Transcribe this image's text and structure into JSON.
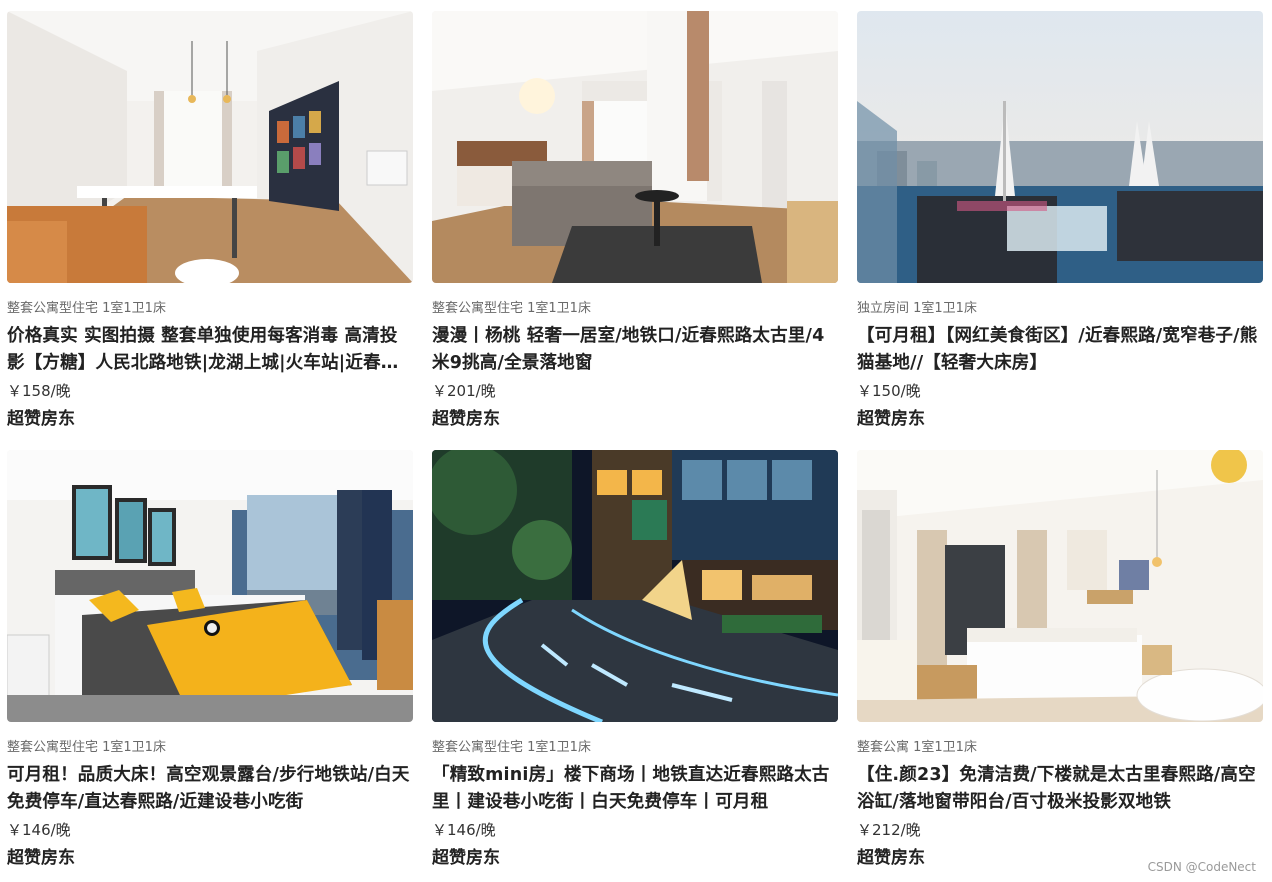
{
  "listings": [
    {
      "type": "整套公寓型住宅 1室1卫1床",
      "title": "价格真实 实图拍摄 整套单独使用每客消毒 高清投影【方糖】人民北路地铁|龙湖上城|火车站|近春熙路",
      "price": "￥158/晚",
      "host_badge": "超赞房东"
    },
    {
      "type": "整套公寓型住宅 1室1卫1床",
      "title": "漫漫丨杨桃 轻奢一居室/地铁口/近春熙路太古里/4米9挑高/全景落地窗",
      "price": "￥201/晚",
      "host_badge": "超赞房东"
    },
    {
      "type": "独立房间 1室1卫1床",
      "title": "【可月租】【网红美食街区】/近春熙路/宽窄巷子/熊猫基地//【轻奢大床房】",
      "price": "￥150/晚",
      "host_badge": "超赞房东"
    },
    {
      "type": "整套公寓型住宅 1室1卫1床",
      "title": "可月租！品质大床！高空观景露台/步行地铁站/白天免费停车/直达春熙路/近建设巷小吃街",
      "price": "￥146/晚",
      "host_badge": "超赞房东"
    },
    {
      "type": "整套公寓型住宅 1室1卫1床",
      "title": "「精致mini房」楼下商场丨地铁直达近春熙路太古里丨建设巷小吃街丨白天免费停车丨可月租",
      "price": "￥146/晚",
      "host_badge": "超赞房东"
    },
    {
      "type": "整套公寓 1室1卫1床",
      "title": "【住.颜23】免清洁费/下楼就是太古里春熙路/高空浴缸/落地窗带阳台/百寸极米投影双地铁",
      "price": "￥212/晚",
      "host_badge": "超赞房东"
    }
  ],
  "watermark": "CSDN @CodeNect"
}
